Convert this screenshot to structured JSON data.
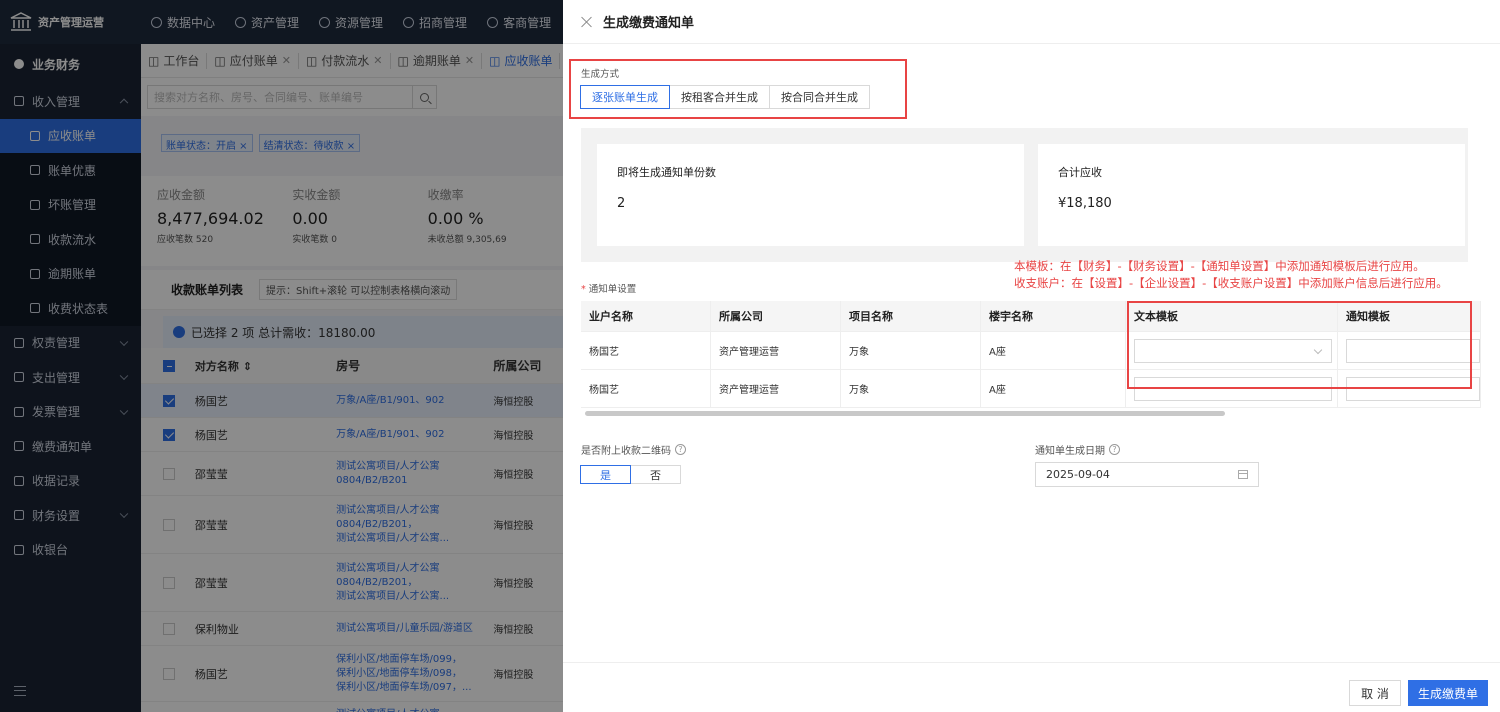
{
  "app": {
    "title": "资产管理运营"
  },
  "topnav": [
    "数据中心",
    "资产管理",
    "资源管理",
    "招商管理",
    "客商管理"
  ],
  "sidebar": {
    "items": [
      {
        "label": "业务财务",
        "level": "top"
      },
      {
        "label": "收入管理",
        "level": "group",
        "expanded": true
      },
      {
        "label": "应收账单",
        "level": "sub",
        "active": true
      },
      {
        "label": "账单优惠",
        "level": "sub"
      },
      {
        "label": "坏账管理",
        "level": "sub"
      },
      {
        "label": "收款流水",
        "level": "sub"
      },
      {
        "label": "逾期账单",
        "level": "sub"
      },
      {
        "label": "收费状态表",
        "level": "sub"
      },
      {
        "label": "权责管理",
        "level": "group"
      },
      {
        "label": "支出管理",
        "level": "group"
      },
      {
        "label": "发票管理",
        "level": "group"
      },
      {
        "label": "缴费通知单",
        "level": "item"
      },
      {
        "label": "收据记录",
        "level": "item"
      },
      {
        "label": "财务设置",
        "level": "group"
      },
      {
        "label": "收银台",
        "level": "item"
      }
    ]
  },
  "tabs": [
    {
      "label": "工作台",
      "closable": false
    },
    {
      "label": "应付账单",
      "closable": true
    },
    {
      "label": "付款流水",
      "closable": true
    },
    {
      "label": "逾期账单",
      "closable": true
    },
    {
      "label": "应收账单",
      "closable": false,
      "active": true
    }
  ],
  "search": {
    "placeholder": "搜索对方名称、房号、合同编号、账单编号"
  },
  "filters": [
    "账单状态：开启",
    "结清状态：待收款"
  ],
  "stats": [
    {
      "label": "应收金额",
      "value": "8,477,694.02",
      "sub": "应收笔数 520"
    },
    {
      "label": "实收金额",
      "value": "0.00",
      "sub": "实收笔数 0"
    },
    {
      "label": "收缴率",
      "value": "0.00 %",
      "sub": "未收总额 9,305,69"
    }
  ],
  "list": {
    "title": "收款账单列表",
    "tip": "提示：Shift+滚轮 可以控制表格横向滚动",
    "selected_text": "已选择 2 项  总计需收：18180.00",
    "columns": [
      "对方名称",
      "房号",
      "所属公司"
    ],
    "rows": [
      {
        "name": "杨国艺",
        "room": "万象/A座/B1/901、902",
        "company": "海恒控股",
        "checked": true
      },
      {
        "name": "杨国艺",
        "room": "万象/A座/B1/901、902",
        "company": "海恒控股",
        "checked": true
      },
      {
        "name": "邵莹莹",
        "room": "测试公寓项目/人才公寓\n0804/B2/B201",
        "company": "海恒控股",
        "checked": false
      },
      {
        "name": "邵莹莹",
        "room": "测试公寓项目/人才公寓\n0804/B2/B201，\n测试公寓项目/人才公寓...",
        "company": "海恒控股",
        "checked": false
      },
      {
        "name": "邵莹莹",
        "room": "测试公寓项目/人才公寓\n0804/B2/B201，\n测试公寓项目/人才公寓...",
        "company": "海恒控股",
        "checked": false
      },
      {
        "name": "保利物业",
        "room": "测试公寓项目/儿童乐园/游道区",
        "company": "海恒控股",
        "checked": false
      },
      {
        "name": "杨国艺",
        "room": "保利小区/地面停车场/099，\n保利小区/地面停车场/098，\n保利小区/地面停车场/097，...",
        "company": "海恒控股",
        "checked": false
      },
      {
        "name": "邵莹莹",
        "room": "测试公寓项目/人才公寓\n0804/B2/B201",
        "company": "海恒控股",
        "checked": false
      }
    ]
  },
  "drawer": {
    "title": "生成缴费通知单",
    "mode_label": "生成方式",
    "modes": [
      "逐张账单生成",
      "按租客合并生成",
      "按合同合并生成"
    ],
    "count_label": "即将生成通知单份数",
    "count_value": "2",
    "total_label": "合计应收",
    "total_value": "¥18,180",
    "warn1": "本模板：在【财务】-【财务设置】-【通知单设置】中添加通知模板后进行应用。",
    "warn2": "收支账户：在【设置】-【企业设置】-【收支账户设置】中添加账户信息后进行应用。",
    "notice_section": "通知单设置",
    "table_columns": [
      "业户名称",
      "所属公司",
      "项目名称",
      "楼宇名称",
      "文本模板",
      "通知模板"
    ],
    "table_rows": [
      {
        "tenant": "杨国艺",
        "company": "资产管理运营",
        "project": "万象",
        "building": "A座"
      },
      {
        "tenant": "杨国艺",
        "company": "资产管理运营",
        "project": "万象",
        "building": "A座"
      }
    ],
    "qr_label": "是否附上收款二维码",
    "qr_options": [
      "是",
      "否"
    ],
    "date_label": "通知单生成日期",
    "date_value": "2025-09-04",
    "cancel_label": "取 消",
    "submit_label": "生成缴费单"
  },
  "colors": {
    "primary": "#2f6fe5",
    "warning": "#e84444",
    "header": "#1e2a3d",
    "sidebar": "#1a2434"
  }
}
